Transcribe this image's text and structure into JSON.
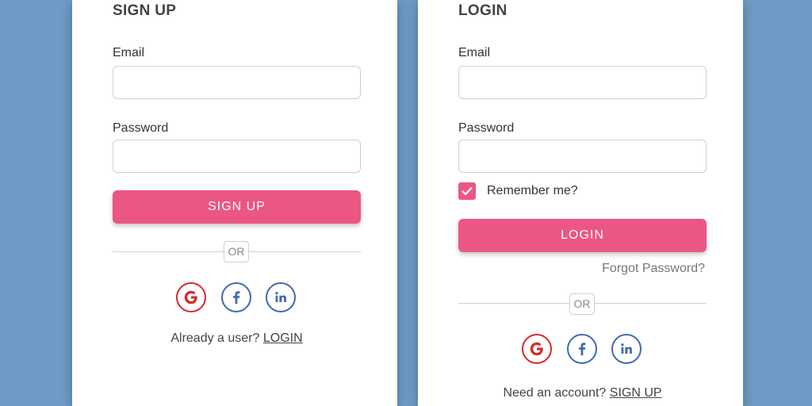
{
  "signup": {
    "title": "SIGN UP",
    "email_label": "Email",
    "email_value": "",
    "password_label": "Password",
    "password_value": "",
    "submit_label": "SIGN UP",
    "or_label": "OR",
    "footer_text": "Already a user? ",
    "footer_link": "LOGIN"
  },
  "login": {
    "title": "LOGIN",
    "email_label": "Email",
    "email_value": "",
    "password_label": "Password",
    "password_value": "",
    "remember_label": "Remember me?",
    "remember_checked": true,
    "submit_label": "LOGIN",
    "forgot_label": "Forgot Password?",
    "or_label": "OR",
    "footer_text": "Need an account? ",
    "footer_link": "SIGN UP"
  },
  "social": {
    "icons": [
      "google-icon",
      "facebook-icon",
      "linkedin-icon"
    ]
  },
  "colors": {
    "background": "#6e9bc5",
    "accent": "#ec5683",
    "google": "#d32b2b",
    "facebook": "#3f6ab0",
    "linkedin": "#3f6ab0"
  }
}
